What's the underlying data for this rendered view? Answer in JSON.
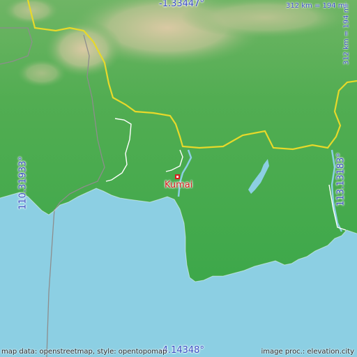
{
  "map": {
    "place": "Kumai",
    "coords": {
      "top": "-1.33447°",
      "bottom": "-4.14348°",
      "left": "110.31933°",
      "right": "113.13183°"
    },
    "scale": {
      "horizontal": "312 km = 194 mi",
      "vertical": "312 km = 194 mi"
    },
    "credits": {
      "left": "map data: openstreetmap, style: opentopomap",
      "right": "image proc.: elevation.city"
    },
    "colors": {
      "sea": "#8ccfe3",
      "lowland": "#3fa84e",
      "upland": "#b7c48f",
      "border": "#e7d92a",
      "city": "#d52020",
      "label": "#3b4fc4"
    }
  }
}
